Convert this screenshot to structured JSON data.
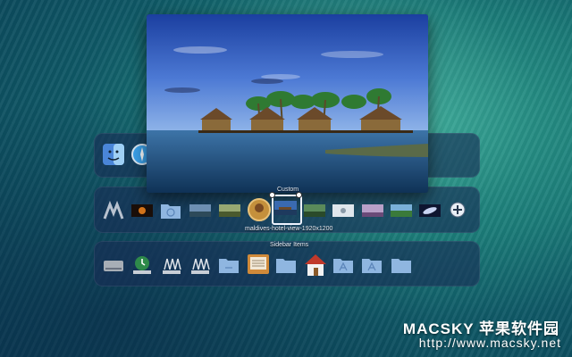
{
  "preview": {
    "caption": "maldives-hotel-view-1920x1200"
  },
  "stack": {
    "title": "Custom"
  },
  "sidebar": {
    "title": "Sidebar Items"
  },
  "watermark": {
    "brand": "MACSKY 苹果软件园",
    "url": "http://www.macsky.net"
  },
  "colors": {
    "shelf": "#192d55",
    "folder": "#8fb6e0",
    "accent": "#e6ecf5"
  }
}
